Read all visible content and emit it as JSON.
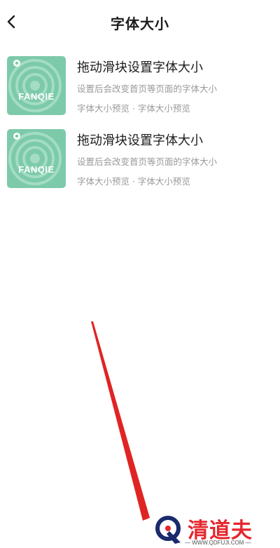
{
  "header": {
    "title": "字体大小",
    "back_icon": "chevron-left-icon"
  },
  "items": [
    {
      "thumbnail_text": "FANQIE",
      "title": "拖动滑块设置字体大小",
      "description": "设置后会改变首页等页面的字体大小",
      "meta": "字体大小预览 · 字体大小预览"
    },
    {
      "thumbnail_text": "FANQIE",
      "title": "拖动滑块设置字体大小",
      "description": "设置后会改变首页等页面的字体大小",
      "meta": "字体大小预览 · 字体大小预览"
    }
  ],
  "watermark": {
    "brand": "清道夫",
    "url": "— WWW.QDFUJI.COM —"
  },
  "colors": {
    "thumbnail_bg": "#7ccaaa",
    "annotation_arrow": "#e02424",
    "watermark_red": "#e6262e"
  }
}
